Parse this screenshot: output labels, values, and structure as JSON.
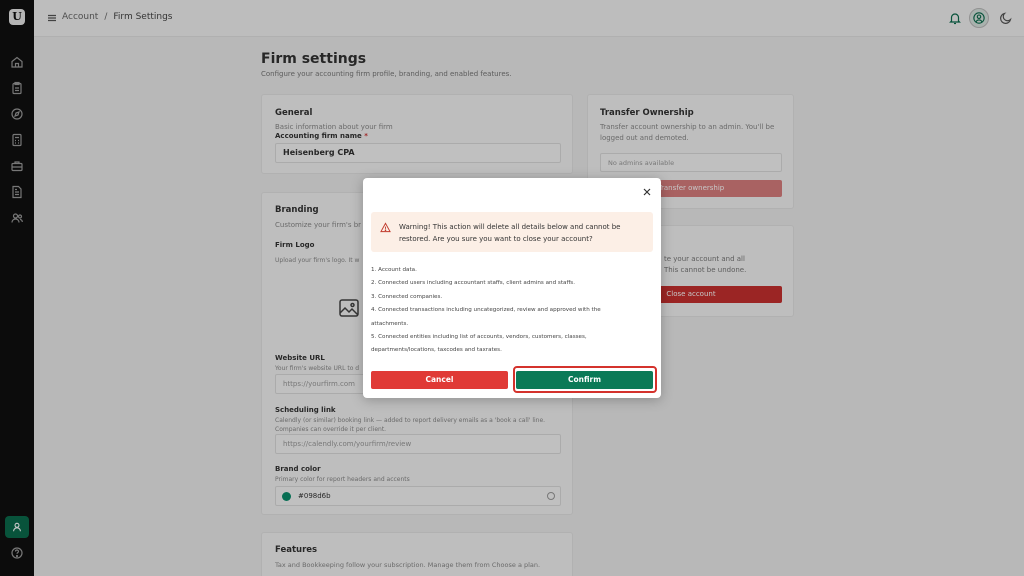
{
  "breadcrumb": {
    "first": "Account",
    "separator": "/",
    "current": "Firm Settings"
  },
  "page": {
    "title": "Firm settings",
    "subtitle": "Configure your accounting firm profile, branding, and enabled features."
  },
  "general": {
    "title": "General",
    "description": "Basic information about your firm",
    "firm_name_label": "Accounting firm name",
    "required_mark": "*",
    "firm_name_value": "Heisenberg CPA"
  },
  "branding": {
    "title": "Branding",
    "description": "Customize your firm's br",
    "logo_label": "Firm Logo",
    "logo_help": "Upload your firm's logo. It w",
    "website_label": "Website URL",
    "website_help": "Your firm's website URL to d",
    "website_placeholder": "https://yourfirm.com",
    "scheduling_label": "Scheduling link",
    "scheduling_help": "Calendly (or similar) booking link — added to report delivery emails as a 'book a call' line. Companies can override it per client.",
    "scheduling_placeholder": "https://calendly.com/yourfirm/review",
    "brand_color_label": "Brand color",
    "brand_color_help": "Primary color for report headers and accents",
    "brand_color_value": "#098d6b"
  },
  "features": {
    "title": "Features",
    "description": "Tax and Bookkeeping follow your subscription. Manage them from Choose a plan."
  },
  "transfer": {
    "title": "Transfer Ownership",
    "description": "Transfer account ownership to an admin. You'll be logged out and demoted.",
    "select_placeholder": "No admins available",
    "button_label": "Transfer ownership"
  },
  "close_account": {
    "description_line1": "te your account and all",
    "description_line2": "This cannot be undone.",
    "button_label": "Close account"
  },
  "modal": {
    "warning": "Warning! This action will delete all details below and cannot be restored. Are you sure you want to close your account?",
    "items": [
      "1. Account data.",
      "2. Connected users including accountant staffs, client admins and staffs.",
      "3. Connected companies.",
      "4. Connected transactions including uncategorized, review and approved with the",
      "attachments.",
      "5. Connected entities including list of accounts, vendors, customers, classes,",
      "departments/locations, taxcodes and taxrates."
    ],
    "cancel_label": "Cancel",
    "confirm_label": "Confirm"
  },
  "colors": {
    "brand": "#098d6b",
    "danger": "#e03a36",
    "confirm": "#0b7a57",
    "sidebar": "#101010"
  },
  "icons": {
    "sidebar": [
      "home-icon",
      "clipboard-icon",
      "compass-icon",
      "calculator-icon",
      "briefcase-icon",
      "document-icon",
      "users-icon",
      "user-icon",
      "help-icon"
    ],
    "topbar": [
      "menu-icon",
      "bell-icon",
      "avatar",
      "moon-icon"
    ],
    "modal": [
      "close-icon",
      "warning-icon",
      "image-icon"
    ]
  }
}
